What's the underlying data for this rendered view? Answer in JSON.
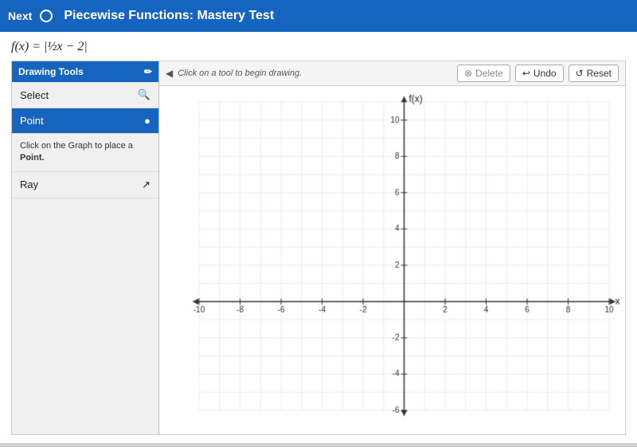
{
  "topbar": {
    "next_label": "Next",
    "title": "Piecewise Functions: Mastery Test"
  },
  "formula": {
    "text": "f(x) = |½x − 2|"
  },
  "drawing_tools": {
    "header": "Drawing Tools",
    "tools": [
      {
        "id": "select",
        "label": "Select",
        "icon": "🔍",
        "active": false
      },
      {
        "id": "point",
        "label": "Point",
        "icon": "●",
        "active": true
      },
      {
        "id": "ray",
        "label": "Ray",
        "icon": "↗",
        "active": false
      }
    ],
    "hint": "Click on the Graph to place a Point."
  },
  "toolbar": {
    "hint": "Click on a tool to begin drawing.",
    "delete_label": "Delete",
    "undo_label": "Undo",
    "reset_label": "Reset"
  },
  "graph": {
    "x_label": "x",
    "y_label": "f(x)",
    "x_min": -10,
    "x_max": 10,
    "y_min": -6,
    "y_max": 10,
    "x_ticks": [
      -10,
      -8,
      -6,
      -4,
      -2,
      2,
      4,
      6,
      8,
      10
    ],
    "y_ticks": [
      -6,
      -4,
      -2,
      2,
      4,
      6,
      8,
      10
    ]
  }
}
